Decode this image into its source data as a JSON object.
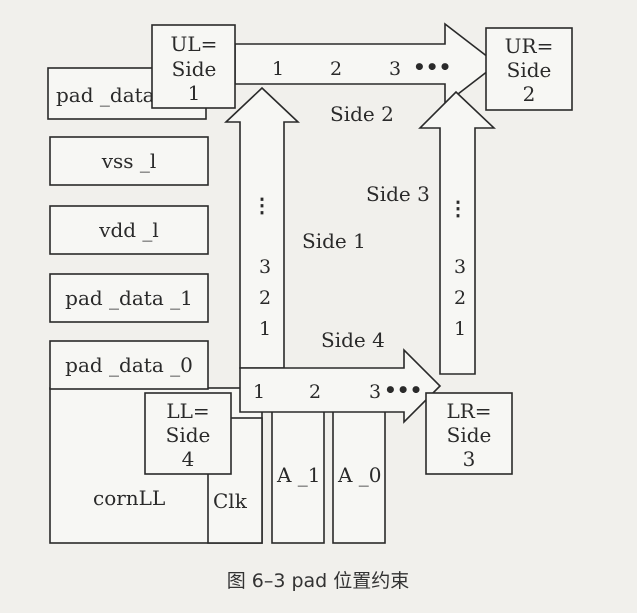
{
  "pads_left": [
    "pad _data",
    "vss _l",
    "vdd _l",
    "pad _data _1",
    "pad _data _0"
  ],
  "corner_ul": [
    "UL=",
    "Side",
    "1"
  ],
  "corner_ur": [
    "UR=",
    "Side",
    "2"
  ],
  "corner_ll": [
    "LL=",
    "Side",
    "4"
  ],
  "corner_lr": [
    "LR=",
    "Side",
    "3"
  ],
  "corn_label": "cornLL",
  "clk_label": "Clk",
  "a1_label": "A _1",
  "a0_label": "A _0",
  "side_labels": {
    "side1": "Side 1",
    "side2": "Side 2",
    "side3": "Side 3",
    "side4": "Side 4"
  },
  "top_arrow": {
    "n1": "1",
    "n2": "2",
    "n3": "3",
    "dots": "•••"
  },
  "bottom_arrow": {
    "n1": "1",
    "n2": "2",
    "n3": "3",
    "dots": "•••"
  },
  "left_arrow": {
    "dots": "⋮",
    "n3": "3",
    "n2": "2",
    "n1": "1"
  },
  "right_arrow": {
    "dots": "⋮",
    "n3": "3",
    "n2": "2",
    "n1": "1"
  },
  "caption": "图 6–3    pad 位置约束"
}
